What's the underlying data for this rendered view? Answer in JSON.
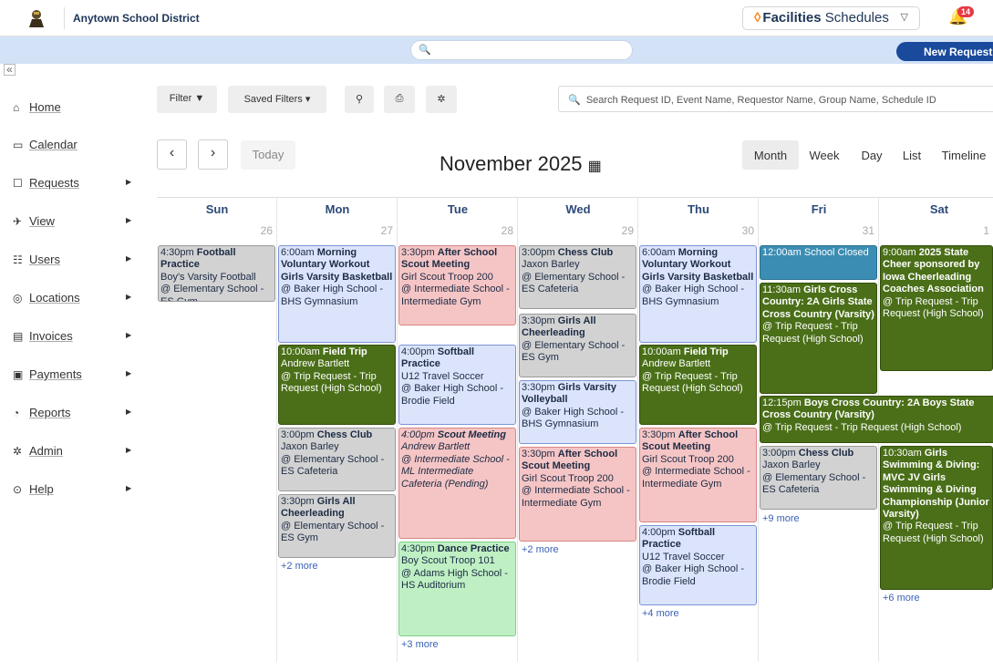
{
  "header": {
    "district": "Anytown School District",
    "facilities_bold": "Facilities",
    "facilities_rest": " Schedules",
    "notification_count": "14",
    "new_request": "New Request"
  },
  "sidebar": {
    "items": [
      {
        "label": "Home",
        "icon": "home-icon",
        "has_arrow": false
      },
      {
        "label": "Calendar",
        "icon": "calendar-icon",
        "has_arrow": false
      },
      {
        "label": "Requests",
        "icon": "requests-icon",
        "has_arrow": true
      },
      {
        "label": "View",
        "icon": "view-icon",
        "has_arrow": true
      },
      {
        "label": "Users",
        "icon": "users-icon",
        "has_arrow": true
      },
      {
        "label": "Locations",
        "icon": "location-icon",
        "has_arrow": true
      },
      {
        "label": "Invoices",
        "icon": "invoice-icon",
        "has_arrow": true
      },
      {
        "label": "Payments",
        "icon": "payment-icon",
        "has_arrow": true
      },
      {
        "label": "Reports",
        "icon": "reports-icon",
        "has_arrow": false
      },
      {
        "label": "Admin",
        "icon": "admin-icon",
        "has_arrow": true
      },
      {
        "label": "Help",
        "icon": "help-icon",
        "has_arrow": true
      }
    ]
  },
  "toolbar": {
    "filter": "Filter",
    "saved_filters": "Saved Filters",
    "search_placeholder": "Search Request ID, Event Name, Requestor Name, Group Name, Schedule ID"
  },
  "calendar": {
    "today": "Today",
    "title": "November 2025",
    "views": [
      "Month",
      "Week",
      "Day",
      "List",
      "Timeline"
    ],
    "active_view": "Month",
    "days": [
      "Sun",
      "Mon",
      "Tue",
      "Wed",
      "Thu",
      "Fri",
      "Sat"
    ],
    "dates": [
      "26",
      "27",
      "28",
      "29",
      "30",
      "31",
      "1"
    ],
    "more": {
      "mon": "+2 more",
      "tue": "+3 more",
      "wed": "+2 more",
      "thu": "+4 more",
      "fri": "+9 more",
      "sat": "+6 more"
    }
  }
}
